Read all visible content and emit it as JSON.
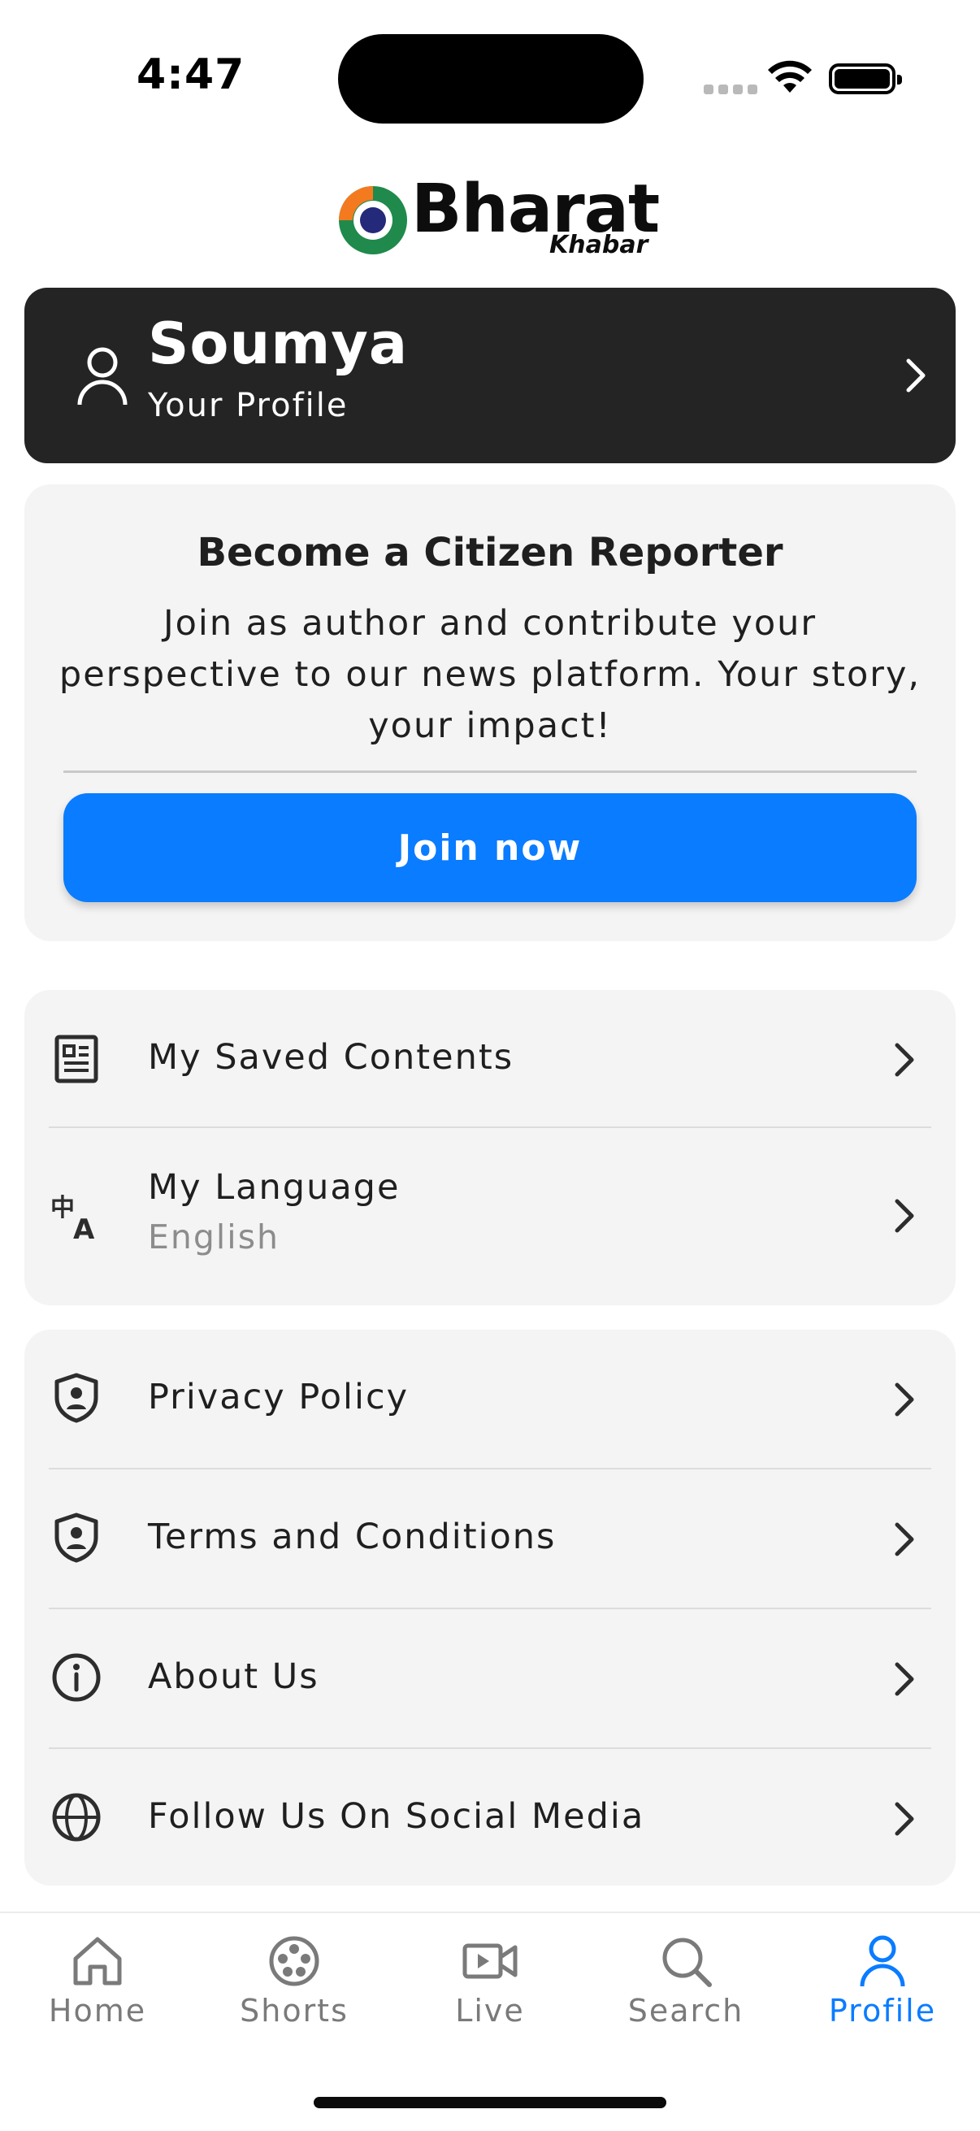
{
  "status_bar": {
    "time": "4:47"
  },
  "brand": {
    "name": "Bharat",
    "sub": "Khabar"
  },
  "profile": {
    "name": "Soumya",
    "subtitle": "Your Profile"
  },
  "reporter": {
    "title": "Become a Citizen Reporter",
    "text": "Join as author and contribute your perspective to our news platform. Your story, your impact!",
    "button": "Join now"
  },
  "menu_group1": [
    {
      "label": "My Saved Contents",
      "icon": "document-icon"
    },
    {
      "label": "My Language",
      "sublabel": "English",
      "icon": "translate-icon"
    }
  ],
  "menu_group2": [
    {
      "label": "Privacy Policy",
      "icon": "shield-user-icon"
    },
    {
      "label": "Terms and Conditions",
      "icon": "shield-user-icon"
    },
    {
      "label": "About Us",
      "icon": "info-icon"
    },
    {
      "label": "Follow Us On Social Media",
      "icon": "globe-icon"
    }
  ],
  "nav": {
    "items": [
      {
        "label": "Home",
        "icon": "home-icon"
      },
      {
        "label": "Shorts",
        "icon": "film-reel-icon"
      },
      {
        "label": "Live",
        "icon": "video-camera-icon"
      },
      {
        "label": "Search",
        "icon": "search-icon"
      },
      {
        "label": "Profile",
        "icon": "user-icon"
      }
    ],
    "active": "Profile"
  },
  "colors": {
    "accent": "#0a7cff",
    "profile_card": "#242424",
    "card_bg": "#f4f4f4"
  }
}
